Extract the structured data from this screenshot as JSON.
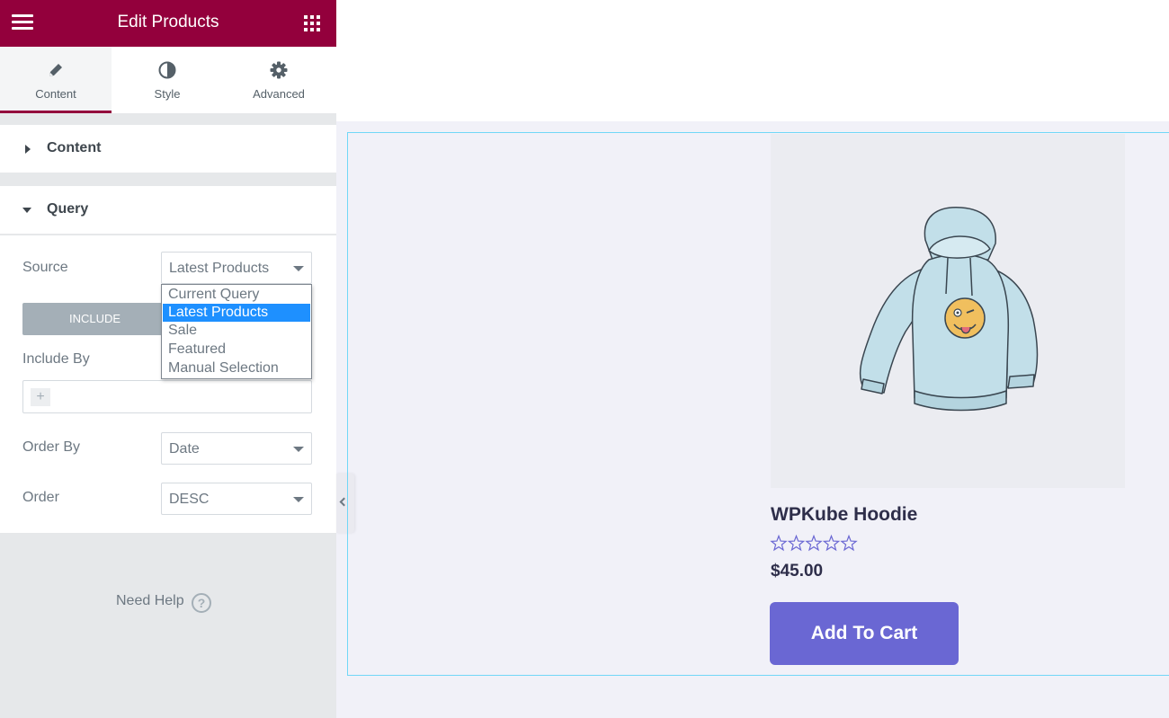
{
  "panel": {
    "title": "Edit Products",
    "tabs": [
      {
        "label": "Content",
        "icon": "pencil-icon",
        "active": true
      },
      {
        "label": "Style",
        "icon": "contrast-icon",
        "active": false
      },
      {
        "label": "Advanced",
        "icon": "gear-icon",
        "active": false
      }
    ],
    "accent_color": "#93003c"
  },
  "sections": {
    "content": {
      "title": "Content",
      "expanded": false
    },
    "query": {
      "title": "Query",
      "expanded": true
    }
  },
  "query": {
    "source": {
      "label": "Source",
      "value": "Latest Products"
    },
    "source_options": [
      "Current Query",
      "Latest Products",
      "Sale",
      "Featured",
      "Manual Selection"
    ],
    "selected_option": "Latest Products",
    "include_tab": "INCLUDE",
    "include_by": {
      "label": "Include By",
      "add_symbol": "+"
    },
    "order_by": {
      "label": "Order By",
      "value": "Date"
    },
    "order": {
      "label": "Order",
      "value": "DESC"
    }
  },
  "help": {
    "label": "Need Help",
    "icon_glyph": "?"
  },
  "product": {
    "title": "WPKube Hoodie",
    "rating": 0,
    "rating_max": 5,
    "price": "$45.00",
    "button_label": "Add To Cart",
    "button_color": "#6a67d3"
  }
}
